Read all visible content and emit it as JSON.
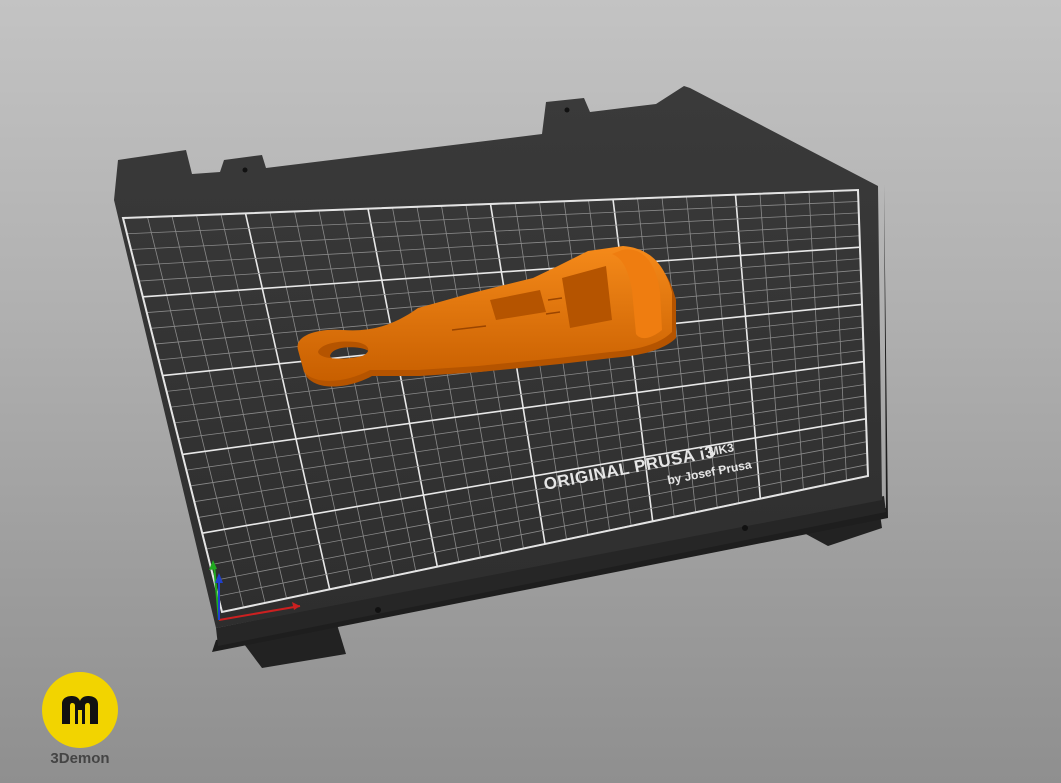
{
  "scene": {
    "background_top": "#c3c3c3",
    "background_bottom": "#8f8f8f",
    "bed_color": "#333333",
    "grid_color": "#d8d8d8",
    "model_color": "#e07000"
  },
  "bed": {
    "brand_line": "ORIGINAL PRUSA i3",
    "model_line": "MK3",
    "author_line": "by Josef Prusa"
  },
  "axes": {
    "x_color": "#cc2020",
    "y_color": "#20aa20",
    "z_color": "#2040cc"
  },
  "model": {
    "icon": "bottle-opener-model"
  },
  "watermark": {
    "text": "3Demon",
    "logo_icon": "3demon-logo-icon",
    "logo_color": "#f2d400"
  }
}
